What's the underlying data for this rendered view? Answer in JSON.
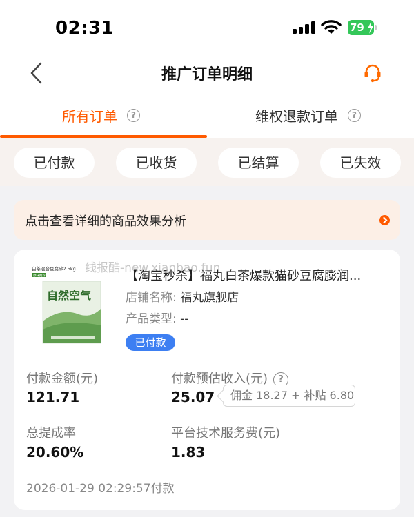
{
  "status_bar": {
    "time": "02:31",
    "battery": "79"
  },
  "nav": {
    "title": "推广订单明细"
  },
  "tabs": [
    {
      "label": "所有订单",
      "help": "?"
    },
    {
      "label": "维权退款订单",
      "help": "?"
    }
  ],
  "filters": [
    "已付款",
    "已收货",
    "已结算",
    "已失效"
  ],
  "banner": {
    "text": "点击查看详细的商品效果分析"
  },
  "order": {
    "watermark": "线报酷-new.xianbao.fun",
    "title": "【淘宝秒杀】福丸白茶爆款猫砂豆腐膨润...",
    "shop_label": "店铺名称:",
    "shop_value": "福丸旗舰店",
    "type_label": "产品类型:",
    "type_value": "--",
    "status": "已付款",
    "thumb_label_top": "白茶混合豆腐砂2.5kg",
    "thumb_badge": "原味推荐",
    "thumb_brand": "自然空气",
    "paid_label": "付款金额(元)",
    "paid_value": "121.71",
    "est_label": "付款预估收入(元)",
    "est_help": "?",
    "est_value": "25.07",
    "tooltip": "佣金 18.27 + 补贴 6.80",
    "rate_label": "总提成率",
    "rate_value": "20.60%",
    "fee_label": "平台技术服务费(元)",
    "fee_value": "1.83",
    "pay_time": "2026-01-29 02:29:57付款"
  },
  "colors": {
    "accent": "#ff5a00",
    "badge": "#3d7ff2",
    "battery": "#34c759"
  }
}
